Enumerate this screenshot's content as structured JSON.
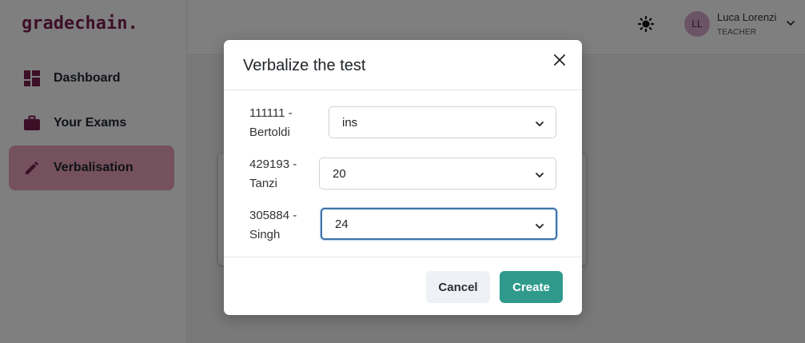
{
  "app": {
    "logo": "gradechain."
  },
  "sidebar": {
    "items": [
      {
        "label": "Dashboard",
        "icon": "dashboard-icon"
      },
      {
        "label": "Your Exams",
        "icon": "briefcase-icon"
      },
      {
        "label": "Verbalisation",
        "icon": "pencil-icon",
        "active": true
      }
    ]
  },
  "header": {
    "theme_icon": "sun-icon",
    "user": {
      "initials": "LL",
      "name": "Luca Lorenzi",
      "role": "TEACHER"
    }
  },
  "modal": {
    "title": "Verbalize the test",
    "rows": [
      {
        "id": "111111 -",
        "name": "Bertoldi",
        "grade": "ins"
      },
      {
        "id": "429193 -",
        "name": "Tanzi",
        "grade": "20"
      },
      {
        "id": "305884 -",
        "name": "Singh",
        "grade": "24"
      }
    ],
    "cancel_label": "Cancel",
    "create_label": "Create"
  },
  "colors": {
    "brand": "#7b1e4f",
    "active_nav": "#e8a2b8",
    "primary_button": "#2f9a8c",
    "focus_border": "#3d73a8"
  }
}
